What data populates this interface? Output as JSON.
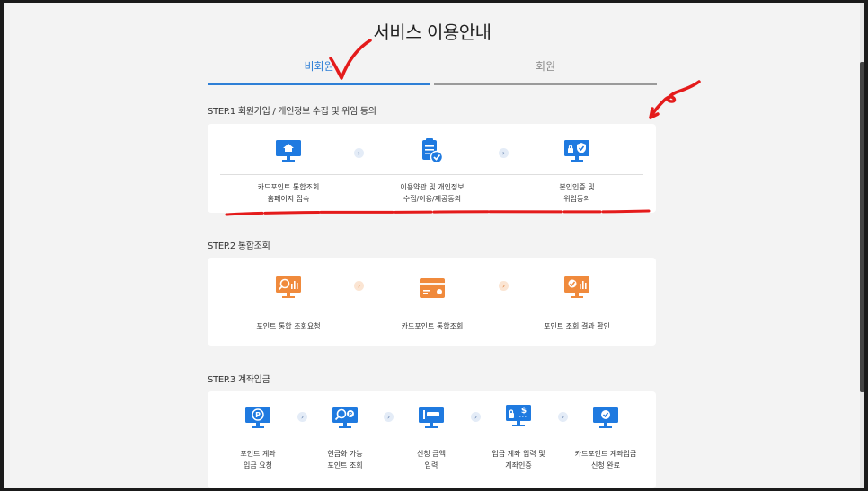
{
  "page": {
    "title": "서비스 이용안내"
  },
  "tabs": [
    {
      "label": "비회원",
      "active": true
    },
    {
      "label": "회원",
      "active": false
    }
  ],
  "steps": [
    {
      "title": "STEP.1 회원가입 / 개인정보 수집 및 위임 동의",
      "items": [
        {
          "label": "카드포인트 통합조회\n홈페이지 접속",
          "icon": "home-monitor-icon"
        },
        {
          "label": "이용약관 및 개인정보\n수집/이용/제공동의",
          "icon": "clipboard-check-icon"
        },
        {
          "label": "본인인증 및\n위임동의",
          "icon": "shield-lock-monitor-icon"
        }
      ]
    },
    {
      "title": "STEP.2 통합조회",
      "items": [
        {
          "label": "포인트 통합 조회요청",
          "icon": "search-chart-monitor-icon"
        },
        {
          "label": "카드포인트 통합조회",
          "icon": "card-icon"
        },
        {
          "label": "포인트 조회 결과 확인",
          "icon": "check-chart-monitor-icon"
        }
      ]
    },
    {
      "title": "STEP.3 계좌입금",
      "items": [
        {
          "label": "포인트 계좌\n입금 요청",
          "icon": "point-monitor-icon"
        },
        {
          "label": "현금화 가능\n포인트 조회",
          "icon": "search-point-monitor-icon"
        },
        {
          "label": "신청 금액\n입력",
          "icon": "amount-monitor-icon"
        },
        {
          "label": "입금 계좌 입력 및\n계좌인증",
          "icon": "dollar-lock-monitor-icon"
        },
        {
          "label": "카드포인트 계좌입금\n신청 완료",
          "icon": "check-monitor-icon"
        }
      ]
    }
  ],
  "colors": {
    "blue": "#2e7fd6",
    "orange": "#f08a3c",
    "annotation_red": "#e41b1b"
  }
}
